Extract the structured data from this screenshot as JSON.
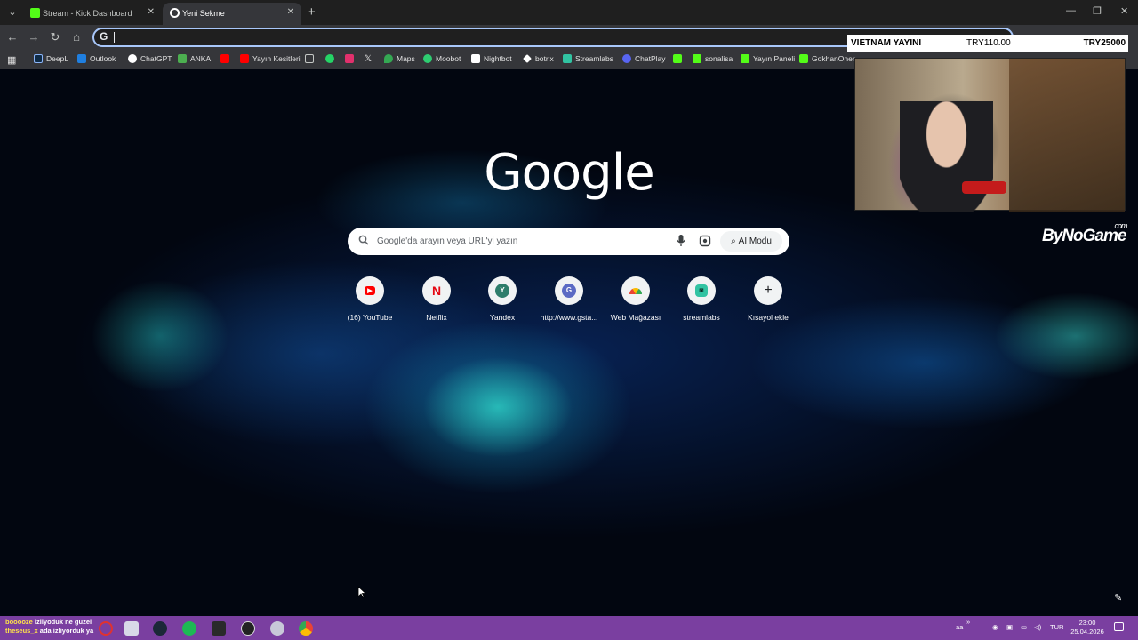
{
  "browser": {
    "tabs": [
      {
        "label": "Stream - Kick Dashboard",
        "active": false,
        "favicon": "kick-icon",
        "color": "#53fc18"
      },
      {
        "label": "Yeni Sekme",
        "active": true,
        "favicon": "chrome-icon",
        "color": "#ffffff"
      }
    ],
    "omnibox_value": "",
    "bookmarks": [
      {
        "label": "DeepL",
        "icon": "deepl-icon",
        "color": "#0f2b46"
      },
      {
        "label": "Outlook",
        "icon": "outlook-icon",
        "color": "#1f7fe0"
      },
      {
        "label": "ChatGPT",
        "icon": "chatgpt-icon",
        "color": "#ffffff"
      },
      {
        "label": "ANKA",
        "icon": "anka-icon",
        "color": "#4caf50"
      },
      {
        "label": "",
        "icon": "youtube-icon",
        "color": "#ff0000"
      },
      {
        "label": "Yayın Kesitleri",
        "icon": "youtube-icon",
        "color": "#ff0000"
      },
      {
        "label": "",
        "icon": "folder-icon",
        "color": "#c4c7c5"
      },
      {
        "label": "",
        "icon": "whatsapp-icon",
        "color": "#25d366"
      },
      {
        "label": "",
        "icon": "instagram-icon",
        "color": "#e1306c"
      },
      {
        "label": "",
        "icon": "x-icon",
        "color": "#ffffff"
      },
      {
        "label": "Maps",
        "icon": "maps-icon",
        "color": "#34a853"
      },
      {
        "label": "Moobot",
        "icon": "moobot-icon",
        "color": "#2ecc71"
      },
      {
        "label": "Nightbot",
        "icon": "nightbot-icon",
        "color": "#ffffff"
      },
      {
        "label": "botrix",
        "icon": "botrix-icon",
        "color": "#ffffff"
      },
      {
        "label": "Streamlabs",
        "icon": "streamlabs-icon",
        "color": "#31c3a2"
      },
      {
        "label": "ChatPlay",
        "icon": "chatplay-icon",
        "color": "#5865f2"
      },
      {
        "label": "",
        "icon": "kick-icon",
        "color": "#53fc18"
      },
      {
        "label": "sonalisa",
        "icon": "kick-icon",
        "color": "#53fc18"
      },
      {
        "label": "Yayın Paneli",
        "icon": "kick-icon",
        "color": "#53fc18"
      },
      {
        "label": "GokhanOner",
        "icon": "kick-icon",
        "color": "#53fc18"
      }
    ]
  },
  "newtab": {
    "logo": "Google",
    "search_placeholder": "Google'da arayın veya URL'yi yazın",
    "ai_mode_label": "AI Modu",
    "shortcuts": [
      {
        "label": "(16) YouTube",
        "glyph": "▶",
        "color": "#ff0000"
      },
      {
        "label": "Netflix",
        "glyph": "N",
        "color": "#e50914"
      },
      {
        "label": "Yandex",
        "glyph": "Y",
        "color": "#ffffff"
      },
      {
        "label": "http://www.gsta...",
        "glyph": "G",
        "color": "#ffffff"
      },
      {
        "label": "Web Mağazası",
        "glyph": "◐",
        "color": "#4285f4"
      },
      {
        "label": "streamlabs",
        "glyph": "◙",
        "color": "#31c3a2"
      },
      {
        "label": "Kısayol ekle",
        "glyph": "+",
        "color": "#202124"
      }
    ]
  },
  "overlay": {
    "donation_title": "VIETNAM YAYINI",
    "donation_current": "TRY110.00",
    "donation_goal": "TRY25000",
    "sponsor_logo": "ByNoGame",
    "sponsor_suffix": ".com"
  },
  "taskbar": {
    "chat_user1": "booooze",
    "chat_msg1": "izliyoduk ne güzel",
    "chat_user2": "theseus_x",
    "chat_msg2": "ada izliyorduk ya",
    "apps": [
      "opera-icon",
      "files-icon",
      "steam-icon",
      "spotify-icon",
      "epic-icon",
      "obs-icon",
      "app-icon",
      "chrome-icon"
    ],
    "tray_ime": "aa",
    "tray_chevron": "»",
    "language": "TUR",
    "time": "23:00",
    "date": "25.04.2026"
  }
}
